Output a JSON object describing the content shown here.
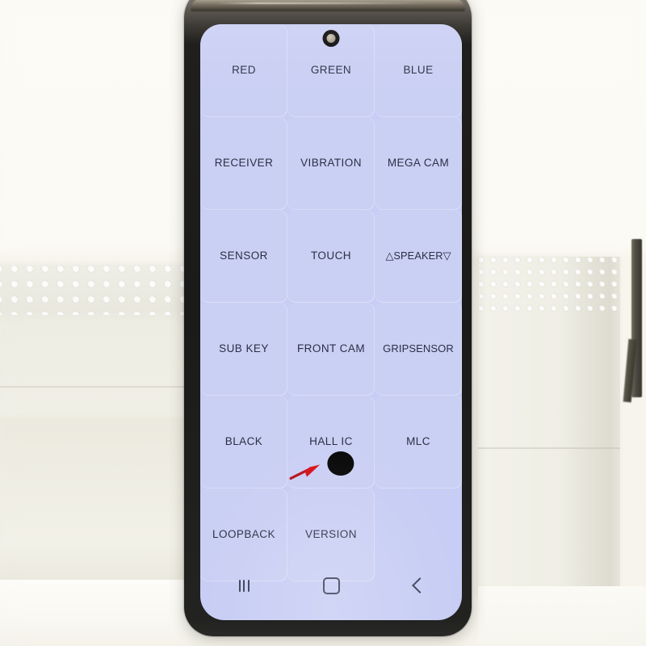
{
  "scene": {
    "subject": "smartphone-display-test-mode",
    "background_description": "styrofoam blocks on white surface",
    "colors": {
      "screen_background": "#c7cdf4",
      "cell_text": "#2b3045",
      "phone_body": "#1a1a19",
      "defect_marker": "#080808",
      "arrow_accent": "#d81018",
      "foam": "#eeede3",
      "backdrop": "#fbfaf5"
    }
  },
  "phone": {
    "screen": {
      "camera_icon": "front-camera-punch-hole",
      "grid": {
        "columns": 3,
        "rows": 6,
        "cells": [
          {
            "label": "RED",
            "empty": false
          },
          {
            "label": "GREEN",
            "empty": false
          },
          {
            "label": "BLUE",
            "empty": false
          },
          {
            "label": "RECEIVER",
            "empty": false
          },
          {
            "label": "VIBRATION",
            "empty": false
          },
          {
            "label": "MEGA CAM",
            "empty": false
          },
          {
            "label": "SENSOR",
            "empty": false
          },
          {
            "label": "TOUCH",
            "empty": false
          },
          {
            "label": "△SPEAKER▽",
            "empty": false
          },
          {
            "label": "SUB KEY",
            "empty": false
          },
          {
            "label": "FRONT CAM",
            "empty": false
          },
          {
            "label": "GRIPSENSOR",
            "empty": false
          },
          {
            "label": "BLACK",
            "empty": false
          },
          {
            "label": "HALL IC",
            "empty": false
          },
          {
            "label": "MLC",
            "empty": false
          },
          {
            "label": "LOOPBACK",
            "empty": false
          },
          {
            "label": "VERSION",
            "empty": false
          },
          {
            "label": "",
            "empty": true
          }
        ],
        "defect": {
          "in_cell_label": "HALL IC",
          "marker_icon": "black-spot-defect",
          "pointer_icon": "red-arrow-icon"
        }
      },
      "navbar": {
        "recents_icon": "recents-bars-icon",
        "home_icon": "home-square-icon",
        "back_icon": "back-chevron-icon"
      }
    }
  }
}
